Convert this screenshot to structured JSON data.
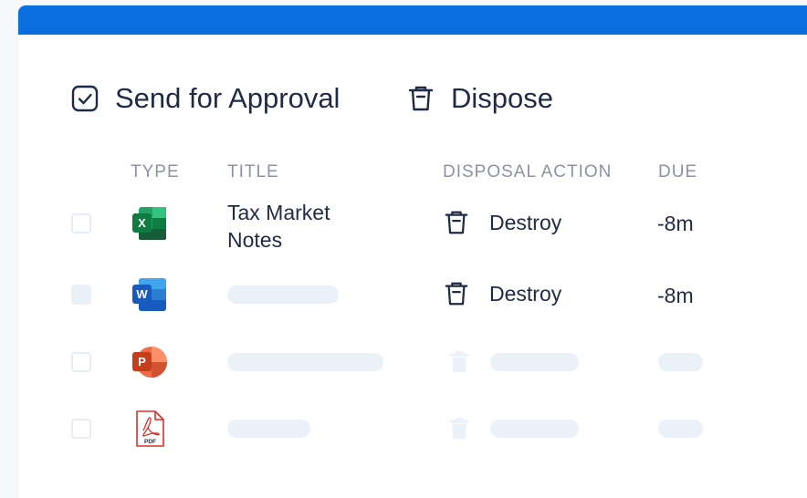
{
  "toolbar": {
    "send_for_approval": "Send for Approval",
    "dispose": "Dispose"
  },
  "table": {
    "columns": [
      "TYPE",
      "TITLE",
      "DISPOSAL ACTION",
      "DUE"
    ],
    "rows": [
      {
        "type_icon": "excel-icon",
        "title_line1": "Tax Market",
        "title_line2": "Notes",
        "action": "Destroy",
        "due": "-8m"
      },
      {
        "type_icon": "word-icon",
        "title_line1": "",
        "title_line2": "",
        "action": "Destroy",
        "due": "-8m"
      },
      {
        "type_icon": "powerpoint-icon",
        "title_line1": "",
        "title_line2": "",
        "action": "",
        "due": ""
      },
      {
        "type_icon": "pdf-icon",
        "title_line1": "",
        "title_line2": "",
        "action": "",
        "due": ""
      }
    ],
    "icon_text": {
      "excel": "X",
      "word": "W",
      "powerpoint": "P",
      "pdf": "PDF"
    }
  },
  "colors": {
    "brand_bar": "#0c6fe0",
    "text": "#1f2a44",
    "muted": "#8a93a6",
    "skeleton": "#eaf1f9"
  }
}
